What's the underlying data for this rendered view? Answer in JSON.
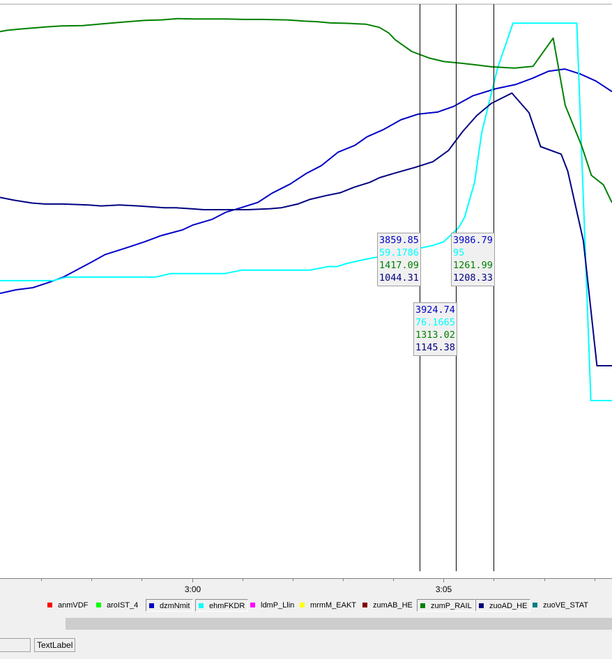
{
  "chart_data": {
    "type": "line",
    "x_unit": "minutes",
    "x_range": [
      296.18,
      308.35
    ],
    "x_ticks": [
      {
        "x": 300,
        "label": "3:00"
      },
      {
        "x": 305,
        "label": "3:05"
      }
    ],
    "x_minor_ticks": [
      297,
      298,
      299,
      301,
      302,
      303,
      304,
      306,
      307,
      308
    ],
    "series": [
      {
        "name": "dzmNmit",
        "color": "#0000c8",
        "ylim": [
          3300,
          4100
        ],
        "x": [
          296.18,
          296.5,
          296.83,
          297.13,
          297.44,
          297.7,
          298.02,
          298.27,
          298.67,
          299.05,
          299.39,
          299.81,
          300.02,
          300.4,
          300.67,
          301.0,
          301.31,
          301.59,
          301.95,
          302.27,
          302.57,
          302.9,
          303.24,
          303.48,
          303.8,
          304.15,
          304.49,
          304.88,
          305.2,
          305.58,
          306.03,
          306.43,
          306.77,
          307.09,
          307.41,
          307.72,
          308.03,
          308.35
        ],
        "y": [
          3692,
          3697,
          3700,
          3707,
          3715,
          3725,
          3737,
          3747,
          3756,
          3765,
          3774,
          3782,
          3789,
          3797,
          3807,
          3814,
          3821,
          3834,
          3847,
          3862,
          3873,
          3892,
          3902,
          3914,
          3924,
          3938,
          3946,
          3949,
          3957,
          3972,
          3982,
          3988,
          3997,
          4007,
          4010,
          4003,
          3993,
          3978
        ]
      },
      {
        "name": "ehmFKDR",
        "color": "#00ffff",
        "ylim": [
          -60,
          100
        ],
        "x": [
          296.18,
          296.48,
          296.86,
          297.23,
          297.5,
          297.91,
          298.28,
          298.6,
          299.02,
          299.27,
          299.57,
          299.94,
          300.28,
          300.64,
          301.0,
          301.36,
          301.71,
          302.01,
          302.35,
          302.71,
          302.88,
          303.11,
          303.43,
          303.8,
          304.12,
          304.46,
          304.79,
          305.0,
          305.3,
          305.42,
          305.62,
          305.76,
          306.07,
          306.38,
          306.54,
          306.87,
          307.06,
          307.13,
          307.4,
          307.65,
          307.93,
          308.35
        ],
        "y": [
          22,
          22,
          22,
          22,
          23,
          23,
          23,
          23,
          23,
          23,
          24,
          24,
          24,
          24,
          25,
          25,
          25,
          25,
          25,
          26,
          26,
          27,
          28,
          29,
          30,
          31,
          32,
          33,
          37,
          40,
          50,
          64,
          82,
          95,
          95,
          95,
          95,
          95,
          95,
          95,
          -12,
          -12
        ]
      },
      {
        "name": "zumP_RAIL",
        "color": "#008000",
        "ylim": [
          400,
          1700
        ],
        "x": [
          296.18,
          296.32,
          296.59,
          296.91,
          297.12,
          297.4,
          297.83,
          298.21,
          298.62,
          299.06,
          299.38,
          299.72,
          300.05,
          300.3,
          300.68,
          301.02,
          301.43,
          301.9,
          302.25,
          302.48,
          302.75,
          303.1,
          303.46,
          303.72,
          303.91,
          304.04,
          304.37,
          304.72,
          305.01,
          305.37,
          305.67,
          305.95,
          306.41,
          306.78,
          307.18,
          307.42,
          307.75,
          307.94,
          308.18,
          308.35
        ],
        "y": [
          1640,
          1643,
          1646,
          1649,
          1651,
          1653,
          1654,
          1658,
          1662,
          1666,
          1667,
          1670,
          1669,
          1669,
          1669,
          1668,
          1668,
          1667,
          1664,
          1663,
          1660,
          1659,
          1657,
          1650,
          1637,
          1621,
          1594,
          1579,
          1571,
          1567,
          1563,
          1559,
          1556,
          1560,
          1625,
          1470,
          1376,
          1309,
          1287,
          1246
        ]
      },
      {
        "name": "zuoAD_HE",
        "color": "#000080",
        "ylim": [
          700,
          1300
        ],
        "x": [
          296.18,
          296.46,
          296.82,
          297.08,
          297.44,
          297.94,
          298.19,
          298.56,
          298.93,
          299.45,
          299.69,
          299.97,
          300.23,
          300.5,
          300.8,
          301.11,
          301.55,
          301.77,
          302.1,
          302.35,
          302.67,
          302.95,
          303.23,
          303.53,
          303.73,
          304.04,
          304.44,
          304.79,
          305.1,
          305.38,
          305.66,
          305.95,
          306.36,
          306.7,
          306.93,
          307.34,
          307.47,
          307.78,
          308.05,
          308.35
        ],
        "y": [
          1096,
          1093,
          1090,
          1089,
          1089,
          1088,
          1087,
          1088,
          1087,
          1085,
          1085,
          1084,
          1083,
          1083,
          1083,
          1083,
          1084,
          1085,
          1089,
          1094,
          1098,
          1101,
          1107,
          1112,
          1117,
          1122,
          1128,
          1134,
          1146,
          1166,
          1183,
          1196,
          1207,
          1186,
          1150,
          1142,
          1124,
          1050,
          917,
          917
        ]
      }
    ],
    "cursors": [
      {
        "x": 304.52,
        "values": [
          "3859.85",
          "59.1786",
          "1417.09",
          "1044.31"
        ]
      },
      {
        "x": 305.25,
        "values": [
          "3924.74",
          "76.1665",
          "1313.02",
          "1145.38"
        ]
      },
      {
        "x": 305.99,
        "values": [
          "3986.79",
          "95",
          "1261.99",
          "1208.33"
        ]
      }
    ],
    "legend": [
      {
        "label": "anmVDF",
        "color": "#ff0000",
        "selected": false
      },
      {
        "label": "aroIST_4",
        "color": "#00ff00",
        "selected": false
      },
      {
        "label": "dzmNmit",
        "color": "#0000c8",
        "selected": true
      },
      {
        "label": "ehmFKDR",
        "color": "#00ffff",
        "selected": true
      },
      {
        "label": "ldmP_Llin",
        "color": "#ff00ff",
        "selected": false
      },
      {
        "label": "mrmM_EAKT",
        "color": "#ffff00",
        "selected": false
      },
      {
        "label": "zumAB_HE",
        "color": "#800000",
        "selected": false
      },
      {
        "label": "zumP_RAIL",
        "color": "#008000",
        "selected": true
      },
      {
        "label": "zuoAD_HE",
        "color": "#000080",
        "selected": true
      },
      {
        "label": "zuoVE_STAT",
        "color": "#008080",
        "selected": false
      }
    ]
  },
  "status": {
    "text_label": "TextLabel"
  }
}
